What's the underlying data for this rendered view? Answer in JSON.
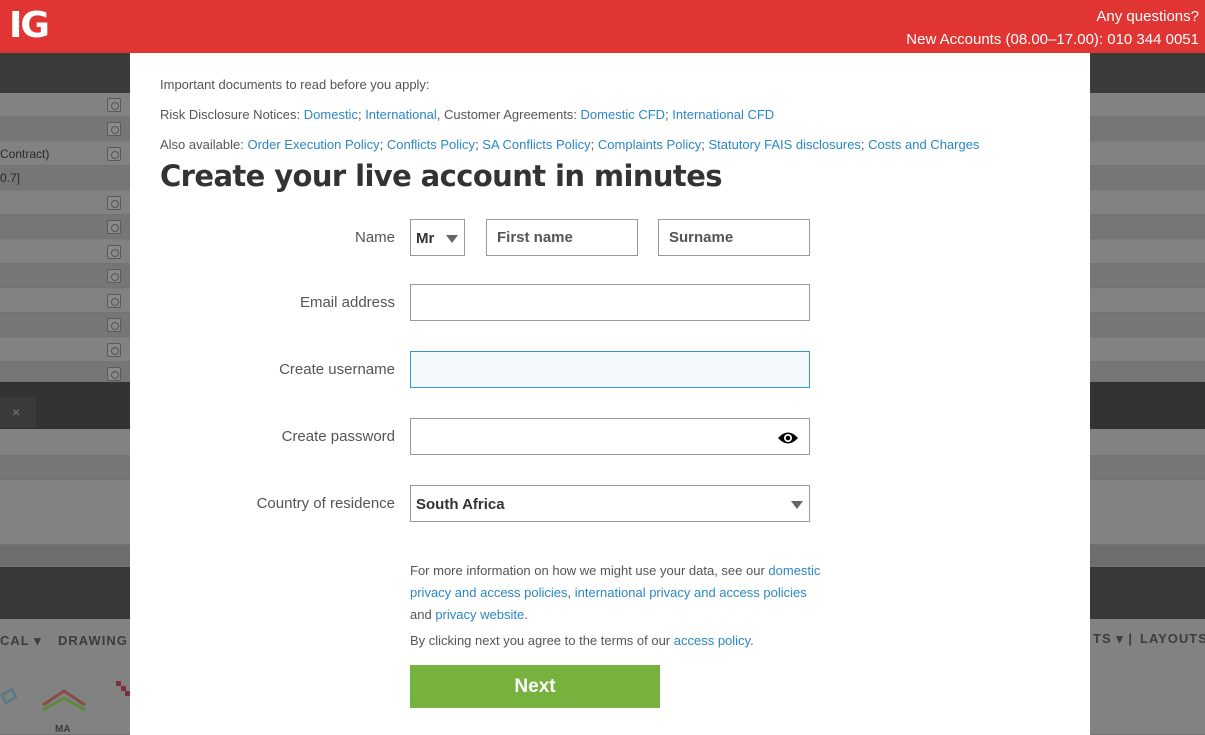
{
  "header": {
    "logo": "IG",
    "contact_line1": "Any questions?",
    "contact_line2": "New Accounts (08.00–17.00): 010 344 0051",
    "brand_color": "#e03532"
  },
  "background_app": {
    "left_texts": [
      "Contract)",
      "0.7]"
    ],
    "toolbar_labels": [
      "CAL ▾",
      "DRAWING",
      "TS ▾ |",
      "LAYOUTS"
    ],
    "indicator_label": "MA"
  },
  "modal": {
    "docs_intro": "Important documents to read before you apply:",
    "risk_prefix": "Risk Disclosure Notices: ",
    "risk_links": [
      "Domestic",
      "International"
    ],
    "agreements_prefix": ", Customer Agreements: ",
    "agreement_links": [
      "Domestic CFD",
      "International CFD"
    ],
    "also_prefix": "Also available: ",
    "also_links": [
      "Order Execution Policy",
      "Conflicts Policy",
      "SA Conflicts Policy",
      "Complaints Policy",
      "Statutory FAIS disclosures",
      "Costs and Charges"
    ],
    "title": "Create your live account in minutes",
    "form": {
      "name_label": "Name",
      "title_select": "Mr",
      "first_name_placeholder": "First name",
      "surname_placeholder": "Surname",
      "email_label": "Email address",
      "email_value": "",
      "username_label": "Create username",
      "username_value": "",
      "password_label": "Create password",
      "password_value": "",
      "country_label": "Country of residence",
      "country_value": "South Africa"
    },
    "privacy_text1": "For more information on how we might use your data, see our ",
    "privacy_link1": "domestic privacy and access policies",
    "privacy_sep": ", ",
    "privacy_link2": "international privacy and access policies",
    "privacy_and": " and ",
    "privacy_link3": "privacy website",
    "privacy_end": ".",
    "agree_text": "By clicking next you agree to the terms of our ",
    "agree_link": "access policy",
    "agree_end": ".",
    "next_button": "Next",
    "accent_link_color": "#2b87c4",
    "button_color": "#78b23e"
  }
}
